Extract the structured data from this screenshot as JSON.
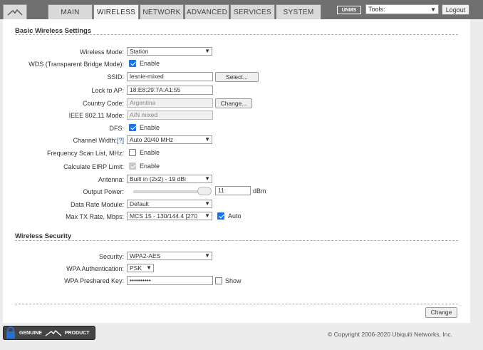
{
  "nav": {
    "tabs": [
      "MAIN",
      "WIRELESS",
      "NETWORK",
      "ADVANCED",
      "SERVICES",
      "SYSTEM"
    ],
    "active": "WIRELESS",
    "unms": "UNMS",
    "tools": "Tools:",
    "logout": "Logout"
  },
  "basic": {
    "title": "Basic Wireless Settings",
    "wireless_mode_label": "Wireless Mode:",
    "wireless_mode_value": "Station",
    "wds_label": "WDS (Transparent Bridge Mode):",
    "wds_enable": "Enable",
    "ssid_label": "SSID:",
    "ssid_value": "lesnie-mixed",
    "ssid_select": "Select...",
    "lock_label": "Lock to AP:",
    "lock_value": "18:E8:29:7A:A1:55",
    "country_label": "Country Code:",
    "country_value": "Argentina",
    "country_change": "Change...",
    "ieee_label": "IEEE 802.11 Mode:",
    "ieee_value": "A/N mixed",
    "dfs_label": "DFS:",
    "dfs_enable": "Enable",
    "channel_width_label": "Channel Width:",
    "channel_width_help": "[?]",
    "channel_width_value": "Auto 20/40 MHz",
    "freq_scan_label": "Frequency Scan List, MHz:",
    "freq_scan_enable": "Enable",
    "eirp_label": "Calculate EIRP Limit:",
    "eirp_enable": "Enable",
    "antenna_label": "Antenna:",
    "antenna_value": "Built in (2x2) - 19 dBi",
    "output_power_label": "Output Power:",
    "output_power_value": "11",
    "output_power_unit": "dBm",
    "data_rate_label": "Data Rate Module:",
    "data_rate_value": "Default",
    "max_tx_label": "Max TX Rate, Mbps:",
    "max_tx_value": "MCS 15 - 130/144.4 [270",
    "max_tx_auto": "Auto"
  },
  "security": {
    "title": "Wireless Security",
    "security_label": "Security:",
    "security_value": "WPA2-AES",
    "wpa_auth_label": "WPA Authentication:",
    "wpa_auth_value": "PSK",
    "psk_label": "WPA Preshared Key:",
    "psk_value": "••••••••••",
    "psk_show": "Show"
  },
  "actions": {
    "change": "Change"
  },
  "footer": {
    "badge_left": "GENUINE",
    "badge_right": "PRODUCT",
    "copyright": "© Copyright 2006-2020 Ubiquiti Networks, Inc."
  }
}
